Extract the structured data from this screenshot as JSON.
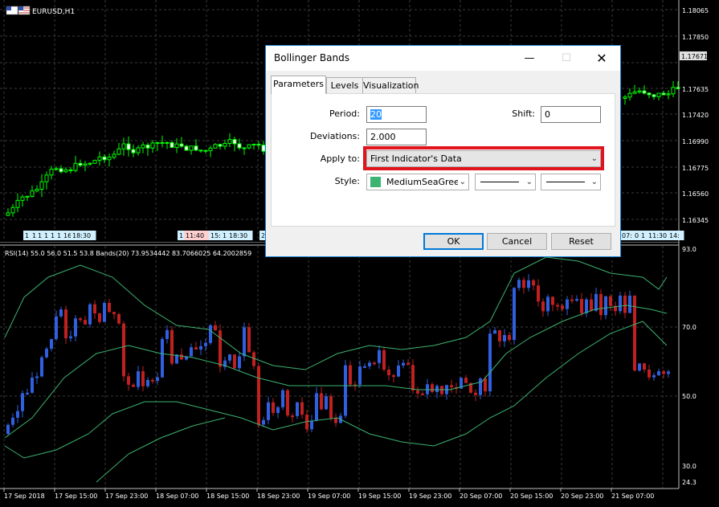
{
  "chart": {
    "symbol": "EURUSD,H1",
    "price_ticks": [
      "1.18065",
      "1.17850",
      "1.17635",
      "1.17420",
      "1.16990",
      "1.16775",
      "1.16560",
      "1.16345"
    ],
    "current_price": "1.17671",
    "upper_time_tags": [
      "1",
      "1",
      "1",
      "1",
      "1",
      "1",
      "16:",
      "18:30",
      "1",
      "11:40",
      "15:",
      "1",
      "18:30",
      "2",
      "07:",
      "0",
      "1",
      "11:30",
      "14:"
    ],
    "indicator_label": "RSI(14) 55.0 56.0 51.5 53.8 Bands(20) 73.9534442 83.7066025 64.2002859",
    "rsi_ticks": [
      "93.0",
      "70.0",
      "50.0",
      "30.0",
      "24.3"
    ],
    "time_labels": [
      "17 Sep 2018",
      "17 Sep 15:00",
      "17 Sep 23:00",
      "18 Sep 07:00",
      "18 Sep 15:00",
      "18 Sep 23:00",
      "19 Sep 07:00",
      "19 Sep 15:00",
      "19 Sep 23:00",
      "20 Sep 07:00",
      "20 Sep 15:00",
      "20 Sep 23:00",
      "21 Sep 07:00"
    ]
  },
  "dialog": {
    "title": "Bollinger Bands",
    "tabs": [
      "Parameters",
      "Levels",
      "Visualization"
    ],
    "period_label": "Period:",
    "period_value": "20",
    "shift_label": "Shift:",
    "shift_value": "0",
    "deviations_label": "Deviations:",
    "deviations_value": "2.000",
    "apply_label": "Apply to:",
    "apply_value": "First Indicator's Data",
    "style_label": "Style:",
    "style_color_name": "MediumSeaGreen",
    "style_color_hex": "#3cb371",
    "ok": "OK",
    "cancel": "Cancel",
    "reset": "Reset"
  },
  "highlight_color": "#e0141e"
}
